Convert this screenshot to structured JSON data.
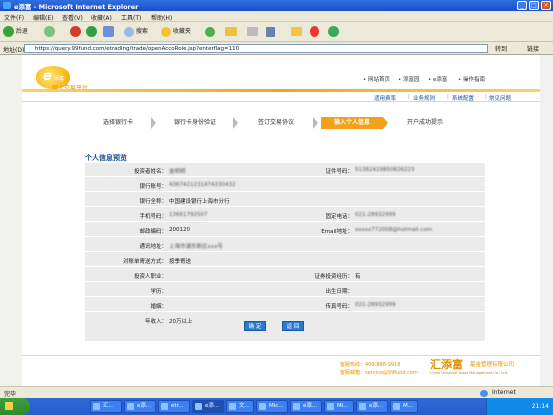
{
  "window": {
    "title": "e添富 - Microsoft Internet Explorer"
  },
  "menu": [
    "文件(F)",
    "编辑(E)",
    "查看(V)",
    "收藏(A)",
    "工具(T)",
    "帮助(H)"
  ],
  "toolbar": {
    "back": "后退",
    "search": "搜索",
    "favorites": "收藏夹"
  },
  "address": {
    "label": "地址(D)",
    "url": "https://query.99fund.com/etrading/trade/openAccoRole.jsp?enterflag=110",
    "go": "转到",
    "links": "链接"
  },
  "site": {
    "brand_sub": "网上交易平台",
    "topnav": [
      "网站首页",
      "添富园",
      "e添富",
      "操作指南"
    ],
    "subnav": [
      "适用费率",
      "业务规则",
      "系统配置",
      "常见问题"
    ]
  },
  "steps": [
    "选择银行卡",
    "银行卡身份验证",
    "签订交易协议",
    "输入个人信息",
    "开户成功提示"
  ],
  "section_title": "个人信息预览",
  "fields": {
    "investor_name": {
      "label": "投资者姓名：",
      "value": "金明明"
    },
    "id_no": {
      "label": "证件号码：",
      "value": "51382419850826223"
    },
    "bank_account": {
      "label": "银行账号：",
      "value": "4367421231474330432"
    },
    "bank_name": {
      "label": "银行全称：",
      "value": "中国建设银行上海市分行"
    },
    "mobile": {
      "label": "手机号码：",
      "value": "13661792507"
    },
    "phone": {
      "label": "固定电话：",
      "value": "021-28932999"
    },
    "postcode": {
      "label": "邮政编码：",
      "value": "200120"
    },
    "email": {
      "label": "Email地址：",
      "value": "xxxxx772008@hotmail.com"
    },
    "address": {
      "label": "通讯地址：",
      "value": "上海市浦东新区xxx号"
    },
    "statement": {
      "label": "对账单寄送方式：",
      "value": "按季寄送"
    },
    "job": {
      "label": "投资人职业：",
      "value": ""
    },
    "experience": {
      "label": "证券投资经历：",
      "value": "有"
    },
    "education": {
      "label": "学历：",
      "value": ""
    },
    "birthday": {
      "label": "出生日期：",
      "value": ""
    },
    "marriage": {
      "label": "婚姻：",
      "value": ""
    },
    "fax": {
      "label": "传真号码：",
      "value": "021-28932999"
    },
    "income": {
      "label": "年收入：",
      "value": "20万以上"
    }
  },
  "buttons": {
    "confirm": "确 定",
    "back": "返 回"
  },
  "footer": {
    "hotline": "客服热线：400-888-9918",
    "email": "客服邮箱：service@99fund.com",
    "company_cn": "汇添富",
    "company_tag": "基金管理有限公司",
    "company_en": "China Universal Asset Management Co., Ltd."
  },
  "status": {
    "left": "完毕",
    "zone": "Internet"
  },
  "taskbar": {
    "items": [
      "汇...",
      "e添...",
      "etr...",
      "e添...",
      "文...",
      "Mic...",
      "e添...",
      "Mi...",
      "e添...",
      "M..."
    ],
    "clock": "21:14"
  }
}
